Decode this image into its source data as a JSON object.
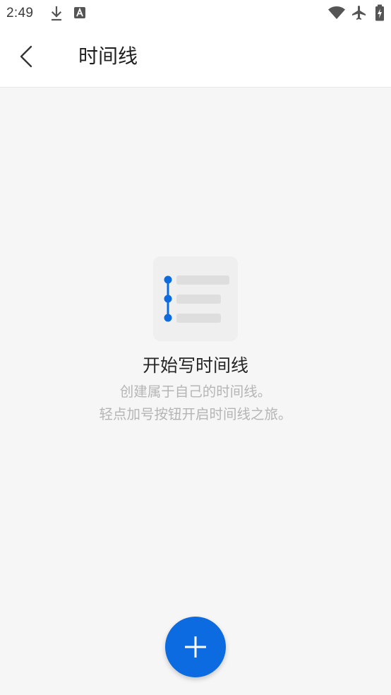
{
  "status_bar": {
    "time": "2:49",
    "left_icons": [
      "download-icon",
      "font-a-icon"
    ],
    "right_icons": [
      "wifi-icon",
      "airplane-mode-icon",
      "battery-charging-icon"
    ]
  },
  "app_bar": {
    "back_icon": "chevron-left-icon",
    "title": "时间线"
  },
  "empty_state": {
    "illustration_icon": "timeline-icon",
    "title": "开始写时间线",
    "lines": [
      "创建属于自己的时间线。",
      "轻点加号按钮开启时间线之旅。"
    ]
  },
  "fab": {
    "icon": "plus-icon"
  },
  "colors": {
    "accent": "#0c6be0",
    "page_background": "#f6f6f6",
    "bar_background": "#ffffff",
    "title_text": "#262626",
    "hint_text": "#b5b5b5",
    "status_icons": "#555555"
  }
}
